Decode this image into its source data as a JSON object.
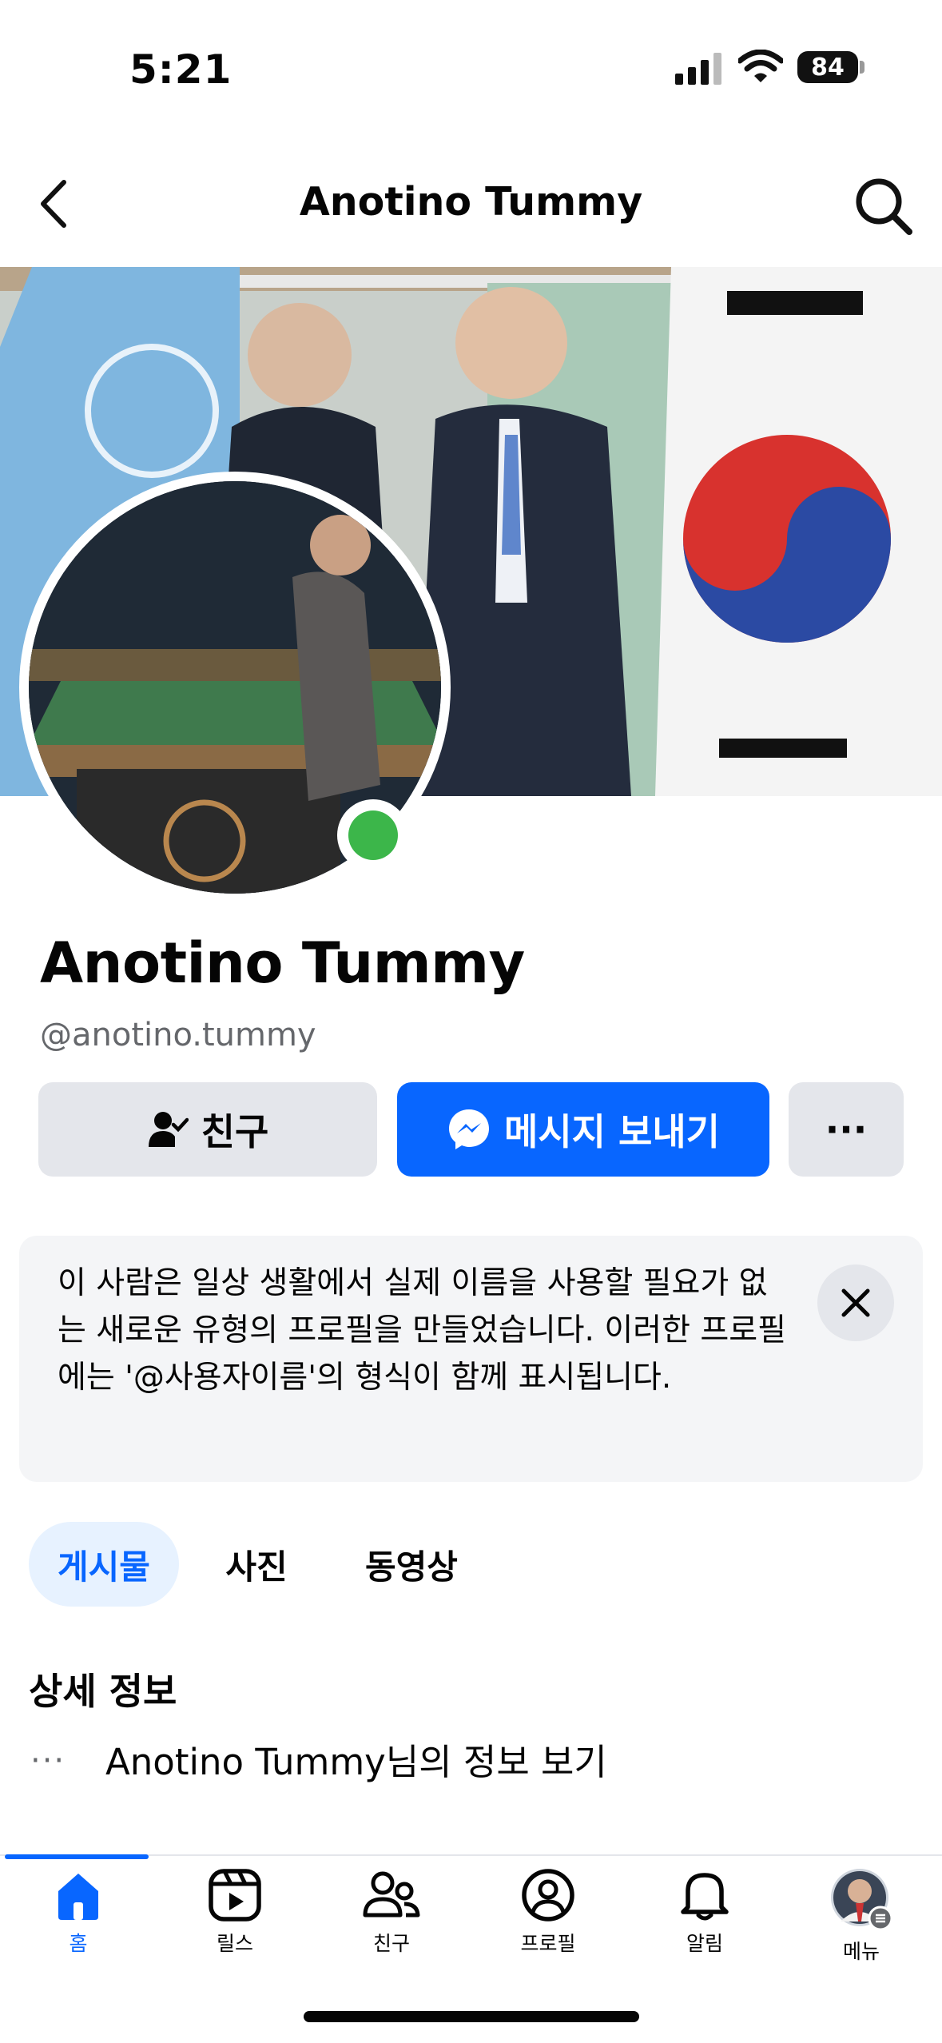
{
  "status_bar": {
    "time": "5:21",
    "battery": "84"
  },
  "header": {
    "title": "Anotino Tummy"
  },
  "profile": {
    "name": "Anotino Tummy",
    "handle": "@anotino.tummy"
  },
  "actions": {
    "friend_label": "친구",
    "message_label": "메시지 보내기",
    "more_label": "···"
  },
  "notice": {
    "text": "이 사람은 일상 생활에서 실제 이름을 사용할 필요가 없는 새로운 유형의 프로필을 만들었습니다. 이러한 프로필에는 '@사용자이름'의 형식이 함께 표시됩니다."
  },
  "tabs": [
    {
      "label": "게시물",
      "active": true
    },
    {
      "label": "사진",
      "active": false
    },
    {
      "label": "동영상",
      "active": false
    }
  ],
  "details": {
    "title": "상세 정보",
    "dots": "···",
    "link": "Anotino Tummy님의 정보 보기"
  },
  "bottom_nav": [
    {
      "label": "홈",
      "icon": "home-icon",
      "active": true
    },
    {
      "label": "릴스",
      "icon": "reels-icon",
      "active": false
    },
    {
      "label": "친구",
      "icon": "friends-icon",
      "active": false
    },
    {
      "label": "프로필",
      "icon": "profile-icon",
      "active": false
    },
    {
      "label": "알림",
      "icon": "bell-icon",
      "active": false
    },
    {
      "label": "메뉴",
      "icon": "menu-avatar-icon",
      "active": false
    }
  ],
  "colors": {
    "accent": "#0866ff",
    "online": "#3cb64a",
    "button_gray": "#e4e6eb"
  }
}
